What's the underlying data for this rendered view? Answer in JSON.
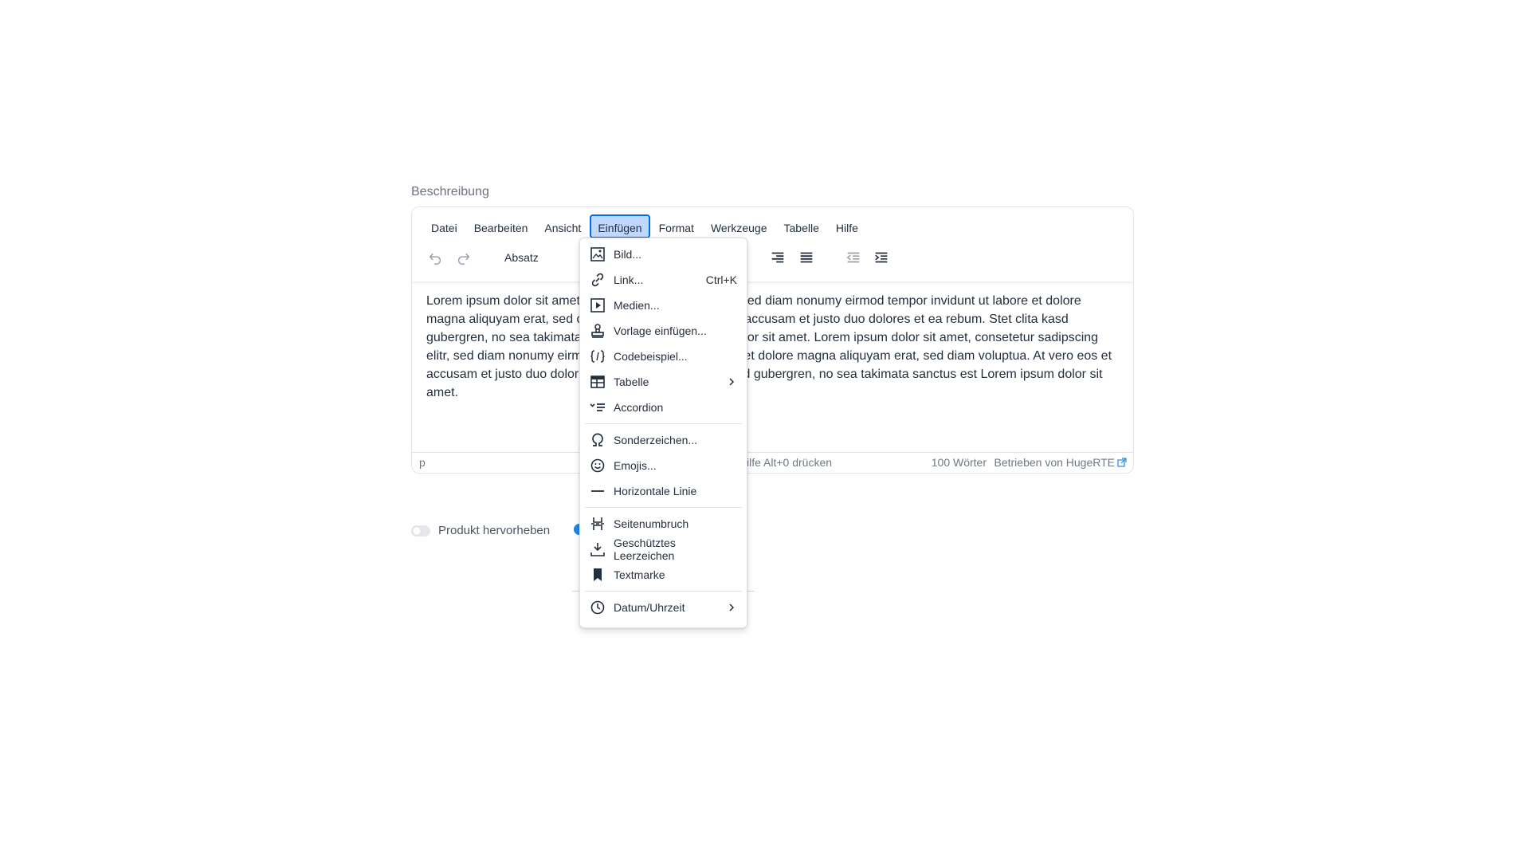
{
  "field": {
    "label": "Beschreibung"
  },
  "menubar": {
    "items": [
      "Datei",
      "Bearbeiten",
      "Ansicht",
      "Einfügen",
      "Format",
      "Werkzeuge",
      "Tabelle",
      "Hilfe"
    ]
  },
  "toolbar": {
    "blocks_value": "Absatz"
  },
  "content": {
    "text": "Lorem ipsum dolor sit amet, consetetur sadipscing elitr, sed diam nonumy eirmod tempor invidunt ut labore et dolore magna aliquyam erat, sed diam voluptua. At vero eos et accusam et justo duo dolores et ea rebum. Stet clita kasd gubergren, no sea takimata sanctus est Lorem ipsum dolor sit amet. Lorem ipsum dolor sit amet, consetetur sadipscing elitr, sed diam nonumy eirmod tempor invidunt ut labore et dolore magna aliquyam erat, sed diam voluptua. At vero eos et accusam et justo duo dolores et ea rebum. Stet clita kasd gubergren, no sea takimata sanctus est Lorem ipsum dolor sit amet."
  },
  "statusbar": {
    "path": "p",
    "help": "Für Hilfe Alt+0 drücken",
    "words": "100 Wörter",
    "brand": "Betrieben von HugeRTE"
  },
  "toggles": {
    "highlight_label": "Produkt hervorheben"
  },
  "insert_menu": {
    "items": [
      {
        "label": "Bild...",
        "icon": "image-icon"
      },
      {
        "label": "Link...",
        "icon": "link-icon",
        "shortcut": "Ctrl+K"
      },
      {
        "label": "Medien...",
        "icon": "media-icon"
      },
      {
        "label": "Vorlage einfügen...",
        "icon": "template-icon"
      },
      {
        "label": "Codebeispiel...",
        "icon": "code-sample-icon"
      },
      {
        "label": "Tabelle",
        "icon": "table-icon",
        "submenu": true
      },
      {
        "label": "Accordion",
        "icon": "accordion-icon"
      },
      {
        "label": "Sonderzeichen...",
        "icon": "omega-icon"
      },
      {
        "label": "Emojis...",
        "icon": "emoji-icon"
      },
      {
        "label": "Horizontale Linie",
        "icon": "horizontal-rule-icon"
      },
      {
        "label": "Seitenumbruch",
        "icon": "page-break-icon"
      },
      {
        "label": "Geschütztes Leerzeichen",
        "icon": "nbsp-icon"
      },
      {
        "label": "Textmarke",
        "icon": "bookmark-icon"
      },
      {
        "label": "Datum/Uhrzeit",
        "icon": "clock-icon",
        "submenu": true
      }
    ]
  },
  "colors": {
    "accent": "#006ce7",
    "active_bg": "#c0d8ff",
    "text": "#222f3e",
    "muted": "#6e7883"
  }
}
